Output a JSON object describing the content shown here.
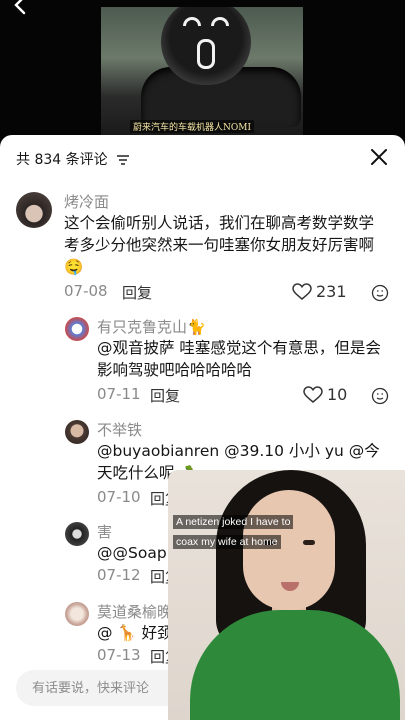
{
  "video": {
    "caption": "蔚来汽车的车载机器人NOMI"
  },
  "header": {
    "count_title": "共 834 条评论",
    "icons": {
      "sort": "sort-icon",
      "close": "close-icon",
      "back": "back-arrow-icon"
    }
  },
  "comments": [
    {
      "name": "烤冷面",
      "text": "这个会偷听别人说话，我们在聊高考数学数学考多少分他突然来一句哇塞你女朋友好厉害啊🤤",
      "date": "07-08",
      "reply": "回复",
      "likes": "231"
    },
    {
      "name": "有只克鲁克山🐈",
      "text": "@观音披萨 哇塞感觉这个有意思，但是会影响驾驶吧哈哈哈哈哈",
      "date": "07-11",
      "reply": "回复",
      "likes": "10"
    },
    {
      "name": "不举铁",
      "text": "@buyaobianren @39.10 小小 yu @今天吃什么呢🥕",
      "date": "07-10",
      "reply": "回复"
    },
    {
      "name": "害",
      "text": "@@Soap",
      "date": "07-12",
      "reply": "回复"
    },
    {
      "name": "莫道桑榆晚 o",
      "text": "@ 🦒 好颈很长颈鹿",
      "date": "07-13",
      "reply": "回复"
    }
  ],
  "input": {
    "placeholder": "有话要说，快来评论"
  },
  "overlay": {
    "caption": "A netizen joked I have to coax my wife at home"
  },
  "colors": {
    "accent_gray": "#8a8a8a",
    "presenter_shirt": "#2e8a3a"
  }
}
